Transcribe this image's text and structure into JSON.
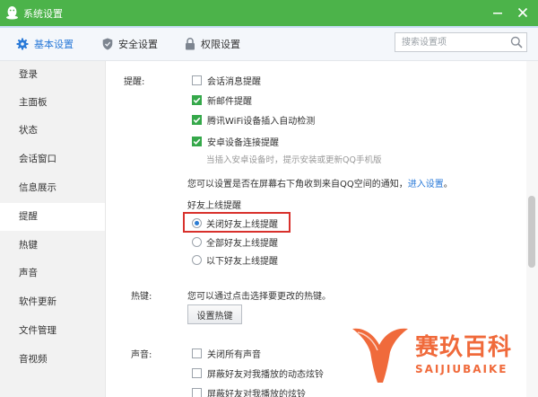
{
  "window": {
    "title": "系统设置"
  },
  "tabs": [
    {
      "label": "基本设置",
      "icon": "gear-icon",
      "active": true
    },
    {
      "label": "安全设置",
      "icon": "shield-icon",
      "active": false
    },
    {
      "label": "权限设置",
      "icon": "lock-icon",
      "active": false
    }
  ],
  "search": {
    "placeholder": "搜索设置项",
    "value": ""
  },
  "sidebar": {
    "items": [
      {
        "label": "登录"
      },
      {
        "label": "主面板"
      },
      {
        "label": "状态"
      },
      {
        "label": "会话窗口"
      },
      {
        "label": "信息展示"
      },
      {
        "label": "提醒",
        "active": true
      },
      {
        "label": "热键"
      },
      {
        "label": "声音"
      },
      {
        "label": "软件更新"
      },
      {
        "label": "文件管理"
      },
      {
        "label": "音视频"
      }
    ]
  },
  "reminder": {
    "section_label": "提醒:",
    "options": [
      {
        "label": "会话消息提醒",
        "checked": false
      },
      {
        "label": "新邮件提醒",
        "checked": true
      },
      {
        "label": "腾讯WiFi设备插入自动检测",
        "checked": true
      },
      {
        "label": "安卓设备连接提醒",
        "checked": true
      }
    ],
    "android_note": "当插入安卓设备时，提示安装或更新QQ手机版",
    "screen_notice_text": "您可以设置是否在屏幕右下角收到来自QQ空间的通知，",
    "screen_notice_link": "进入设置",
    "screen_notice_end": "。",
    "friend_online_label": "好友上线提醒",
    "friend_online_options": [
      {
        "label": "关闭好友上线提醒",
        "selected": true
      },
      {
        "label": "全部好友上线提醒",
        "selected": false
      },
      {
        "label": "以下好友上线提醒",
        "selected": false
      }
    ]
  },
  "hotkey": {
    "section_label": "热键:",
    "description": "您可以通过点击选择要更改的热键。",
    "button_label": "设置热键"
  },
  "sound": {
    "section_label": "声音:",
    "options": [
      {
        "label": "关闭所有声音",
        "checked": false
      },
      {
        "label": "屏蔽好友对我播放的动态炫铃",
        "checked": false
      },
      {
        "label": "屏蔽好友对我播放的炫铃",
        "checked": false
      }
    ]
  },
  "watermark": {
    "brand_cn": "赛玖百科",
    "brand_en": "SAIJIUBAIKE"
  },
  "colors": {
    "titlebar": "#4cb34a",
    "accent": "#2a7ad8",
    "check": "#35a84a",
    "highlight": "#d8312c",
    "watermark": "#f06a3b"
  }
}
